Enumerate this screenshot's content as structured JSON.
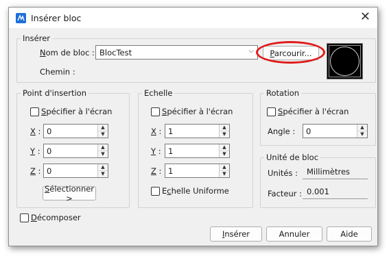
{
  "window": {
    "title": "Insérer bloc",
    "close_glyph": "✕"
  },
  "inserer": {
    "legend": "Insérer",
    "nom_label_u": "N",
    "nom_label_rest": "om de bloc :",
    "bloc_value": "BlocTest",
    "parcourir_u": "P",
    "parcourir_rest": "arcourir...",
    "chemin_label": "Chemin :"
  },
  "insertion": {
    "legend": "Point d'insertion",
    "specifier_u": "S",
    "specifier_rest": "pécifier à l'écran",
    "x_u": "X",
    "y_u": "Y",
    "z_u": "Z",
    "colon": ":",
    "x": "0",
    "y": "0",
    "z": "0",
    "selectionner_u": "S",
    "selectionner_rest": "électionner >"
  },
  "echelle": {
    "legend": "Echelle",
    "specifier_u": "S",
    "specifier_rest": "pécifier à l'écran",
    "x_u": "X",
    "y_u": "Y",
    "z_u": "Z",
    "colon": ":",
    "x": "1",
    "y": "1",
    "z": "1",
    "uniforme_pre": "E",
    "uniforme_u": "c",
    "uniforme_rest": "helle Uniforme"
  },
  "rotation": {
    "legend": "Rotation",
    "specifier_u": "S",
    "specifier_rest": "pécifier à l'écran",
    "angle_label": "Angle :",
    "angle": "0"
  },
  "unite": {
    "legend": "Unité de bloc",
    "unites_label": "Unités :",
    "unites_value": "Millimètres",
    "facteur_label": "Facteur :",
    "facteur_value": "0.001"
  },
  "decomposer": {
    "u": "D",
    "rest": "écomposer"
  },
  "buttons": {
    "inserer_u": "I",
    "inserer_rest": "nsérer",
    "annuler": "Annuler",
    "aide": "Aide"
  },
  "colors": {
    "highlight": "#e01b1b",
    "icon": "#1e6fd9"
  },
  "icons": {
    "app": "app-icon",
    "close": "close-icon"
  }
}
